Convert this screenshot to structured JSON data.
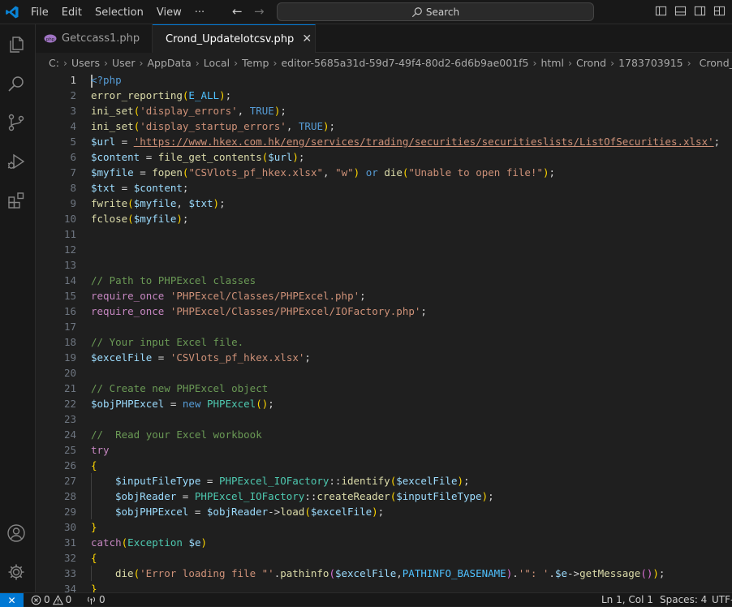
{
  "menu": [
    "File",
    "Edit",
    "Selection",
    "View",
    "···"
  ],
  "search": {
    "label": "Search"
  },
  "tabs": [
    {
      "label": "Getccass1.php",
      "active": false
    },
    {
      "label": "Crond_Updatelotcsv.php",
      "active": true
    }
  ],
  "breadcrumb": [
    "C:",
    "Users",
    "User",
    "AppData",
    "Local",
    "Temp",
    "editor-5685a31d-59d7-49f4-80d2-6d6b9ae001f5",
    "html",
    "Crond",
    "1783703915",
    "Crond_Upda"
  ],
  "editor": {
    "line_numbers": [
      "1",
      "2",
      "3",
      "4",
      "5",
      "6",
      "7",
      "8",
      "9",
      "10",
      "11",
      "12",
      "13",
      "14",
      "15",
      "16",
      "17",
      "18",
      "19",
      "20",
      "21",
      "22",
      "23",
      "24",
      "25",
      "26",
      "27",
      "28",
      "29",
      "30",
      "31",
      "32",
      "33",
      "34"
    ],
    "lines": [
      "<?php",
      "error_reporting(E_ALL);",
      "ini_set('display_errors', TRUE);",
      "ini_set('display_startup_errors', TRUE);",
      "$url = 'https://www.hkex.com.hk/eng/services/trading/securities/securitieslists/ListOfSecurities.xlsx';",
      "$content = file_get_contents($url);",
      "$myfile = fopen(\"CSVlots_pf_hkex.xlsx\", \"w\") or die(\"Unable to open file!\");",
      "$txt = $content;",
      "fwrite($myfile, $txt);",
      "fclose($myfile);",
      "",
      "",
      "",
      "// Path to PHPExcel classes",
      "require_once 'PHPExcel/Classes/PHPExcel.php';",
      "require_once 'PHPExcel/Classes/PHPExcel/IOFactory.php';",
      "",
      "// Your input Excel file.",
      "$excelFile = 'CSVlots_pf_hkex.xlsx';",
      "",
      "// Create new PHPExcel object",
      "$objPHPExcel = new PHPExcel();",
      "",
      "//  Read your Excel workbook",
      "try",
      "{",
      "    $inputFileType = PHPExcel_IOFactory::identify($excelFile);",
      "    $objReader = PHPExcel_IOFactory::createReader($inputFileType);",
      "    $objPHPExcel = $objReader->load($excelFile);",
      "}",
      "catch(Exception $e)",
      "{",
      "    die('Error loading file \"'.pathinfo($excelFile,PATHINFO_BASENAME).'\": '.$e->getMessage());",
      "}"
    ]
  },
  "status": {
    "errors": "0",
    "warnings": "0",
    "ports": "0",
    "position": "Ln 1, Col 1",
    "spaces": "Spaces: 4",
    "encoding": "UTF-"
  },
  "colors": {
    "accent": "#0078d4",
    "background": "#1f1f1f",
    "chrome": "#181818"
  }
}
